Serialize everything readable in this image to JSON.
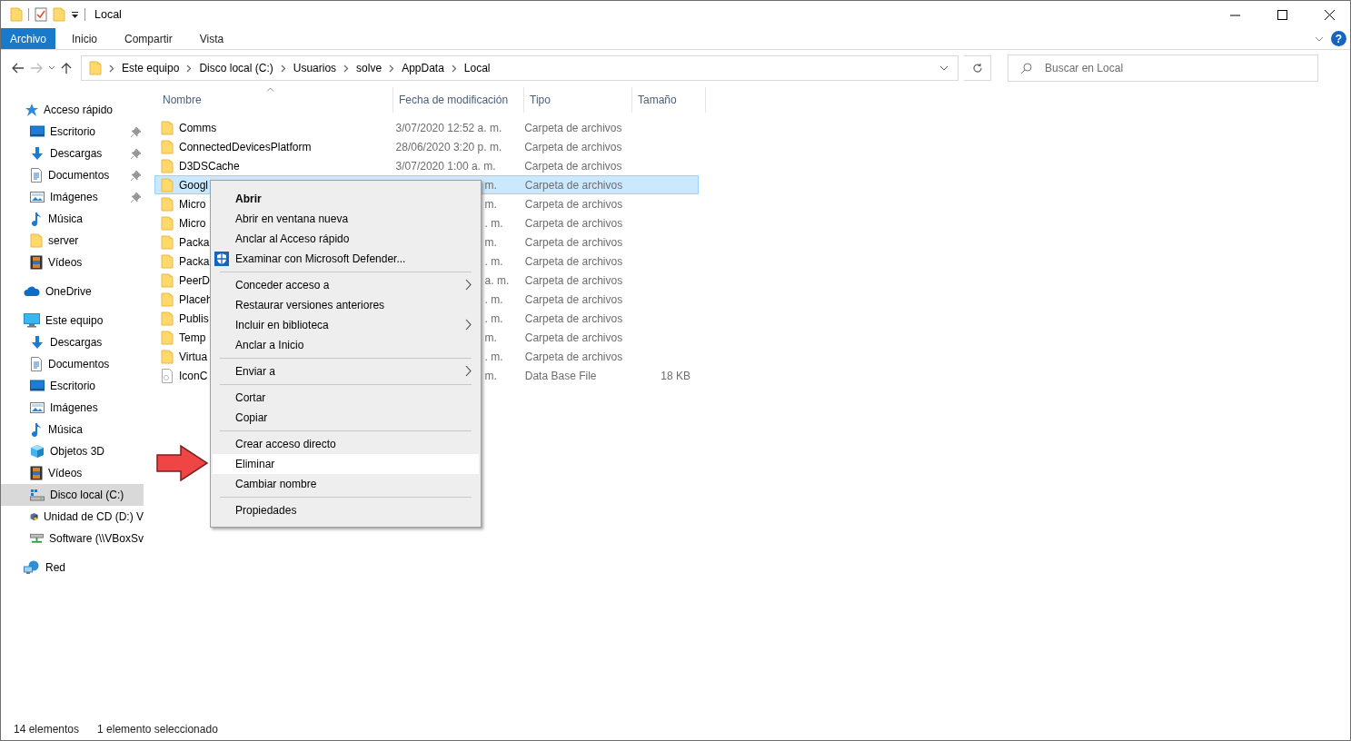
{
  "window": {
    "title": "Local"
  },
  "ribbon": {
    "tabs": [
      {
        "label": "Archivo",
        "selected": true
      },
      {
        "label": "Inicio",
        "selected": false
      },
      {
        "label": "Compartir",
        "selected": false
      },
      {
        "label": "Vista",
        "selected": false
      }
    ],
    "help": "?"
  },
  "address": {
    "segments": [
      "Este equipo",
      "Disco local (C:)",
      "Usuarios",
      "solve",
      "AppData",
      "Local"
    ]
  },
  "search": {
    "placeholder": "Buscar en Local"
  },
  "sidebar": {
    "items": [
      {
        "label": "Acceso rápido",
        "kind": "star",
        "selected": false,
        "children": [
          {
            "label": "Escritorio",
            "kind": "desktop",
            "pinned": true,
            "selected": false
          },
          {
            "label": "Descargas",
            "kind": "download",
            "pinned": true,
            "selected": false
          },
          {
            "label": "Documentos",
            "kind": "document",
            "pinned": true,
            "selected": false
          },
          {
            "label": "Imágenes",
            "kind": "pictures",
            "pinned": true,
            "selected": false
          },
          {
            "label": "Música",
            "kind": "music",
            "pinned": false,
            "selected": false
          },
          {
            "label": "server",
            "kind": "folder",
            "pinned": false,
            "selected": false
          },
          {
            "label": "Vídeos",
            "kind": "video",
            "pinned": false,
            "selected": false
          }
        ]
      },
      {
        "label": "OneDrive",
        "kind": "cloud",
        "selected": false
      },
      {
        "label": "Este equipo",
        "kind": "computer",
        "selected": false,
        "children": [
          {
            "label": "Descargas",
            "kind": "download",
            "pinned": false,
            "selected": false
          },
          {
            "label": "Documentos",
            "kind": "document",
            "pinned": false,
            "selected": false
          },
          {
            "label": "Escritorio",
            "kind": "desktop",
            "pinned": false,
            "selected": false
          },
          {
            "label": "Imágenes",
            "kind": "pictures",
            "pinned": false,
            "selected": false
          },
          {
            "label": "Música",
            "kind": "music",
            "pinned": false,
            "selected": false
          },
          {
            "label": "Objetos 3D",
            "kind": "cube",
            "pinned": false,
            "selected": false
          },
          {
            "label": "Vídeos",
            "kind": "video",
            "pinned": false,
            "selected": false
          },
          {
            "label": "Disco local (C:)",
            "kind": "drive",
            "pinned": false,
            "selected": true
          },
          {
            "label": "Unidad de CD (D:) V",
            "kind": "cd",
            "pinned": false,
            "selected": false
          },
          {
            "label": "Software (\\\\VBoxSv",
            "kind": "netdrive",
            "pinned": false,
            "selected": false
          }
        ]
      },
      {
        "label": "Red",
        "kind": "network",
        "selected": false
      }
    ]
  },
  "table": {
    "columns": [
      "Nombre",
      "Fecha de modificación",
      "Tipo",
      "Tamaño"
    ],
    "rows": [
      {
        "name": "Comms",
        "date": "3/07/2020 12:52 a. m.",
        "type": "Carpeta de archivos",
        "kind": "folder",
        "selected": false
      },
      {
        "name": "ConnectedDevicesPlatform",
        "date": "28/06/2020 3:20 p. m.",
        "type": "Carpeta de archivos",
        "kind": "folder",
        "selected": false
      },
      {
        "name": "D3DSCache",
        "date": "3/07/2020 1:00 a. m.",
        "type": "Carpeta de archivos",
        "kind": "folder",
        "selected": false
      },
      {
        "name": "Googl",
        "date": "m.",
        "type": "Carpeta de archivos",
        "kind": "folder",
        "selected": true,
        "covered": true
      },
      {
        "name": "Micro",
        "date": "m.",
        "type": "Carpeta de archivos",
        "kind": "folder",
        "selected": false,
        "covered": true
      },
      {
        "name": "Micro",
        "date": ". m.",
        "type": "Carpeta de archivos",
        "kind": "folder",
        "selected": false,
        "covered": true
      },
      {
        "name": "Packa",
        "date": "m.",
        "type": "Carpeta de archivos",
        "kind": "folder",
        "selected": false,
        "covered": true
      },
      {
        "name": "Packa",
        "date": ". m.",
        "type": "Carpeta de archivos",
        "kind": "folder",
        "selected": false,
        "covered": true
      },
      {
        "name": "PeerD",
        "date": "a. m.",
        "type": "Carpeta de archivos",
        "kind": "folder",
        "selected": false,
        "covered": true
      },
      {
        "name": "Placeh",
        "date": ". m.",
        "type": "Carpeta de archivos",
        "kind": "folder",
        "selected": false,
        "covered": true
      },
      {
        "name": "Publis",
        "date": ". m.",
        "type": "Carpeta de archivos",
        "kind": "folder",
        "selected": false,
        "covered": true
      },
      {
        "name": "Temp",
        "date": "m.",
        "type": "Carpeta de archivos",
        "kind": "folder",
        "selected": false,
        "covered": true
      },
      {
        "name": "Virtua",
        "date": ". m.",
        "type": "Carpeta de archivos",
        "kind": "folder",
        "selected": false,
        "covered": true
      },
      {
        "name": "IconC",
        "date": "m.",
        "type": "Data Base File",
        "size": "18 KB",
        "kind": "file",
        "selected": false,
        "covered": true
      }
    ]
  },
  "context_menu": {
    "groups": [
      [
        {
          "label": "Abrir",
          "bold": true,
          "selected": false
        },
        {
          "label": "Abrir en ventana nueva",
          "selected": false
        },
        {
          "label": "Anclar al Acceso rápido",
          "selected": false
        },
        {
          "label": "Examinar con Microsoft Defender...",
          "kind": "shield",
          "selected": false
        }
      ],
      [
        {
          "label": "Conceder acceso a",
          "submenu": true,
          "selected": false
        },
        {
          "label": "Restaurar versiones anteriores",
          "selected": false
        },
        {
          "label": "Incluir en biblioteca",
          "submenu": true,
          "selected": false
        },
        {
          "label": "Anclar a Inicio",
          "selected": false
        }
      ],
      [
        {
          "label": "Enviar a",
          "submenu": true,
          "selected": false
        }
      ],
      [
        {
          "label": "Cortar",
          "selected": false
        },
        {
          "label": "Copiar",
          "selected": false
        }
      ],
      [
        {
          "label": "Crear acceso directo",
          "selected": false
        },
        {
          "label": "Eliminar",
          "selected": true
        },
        {
          "label": "Cambiar nombre",
          "selected": false
        }
      ],
      [
        {
          "label": "Propiedades",
          "selected": false
        }
      ]
    ]
  },
  "status_bar": {
    "count": "14 elementos",
    "selection": "1 elemento seleccionado"
  }
}
